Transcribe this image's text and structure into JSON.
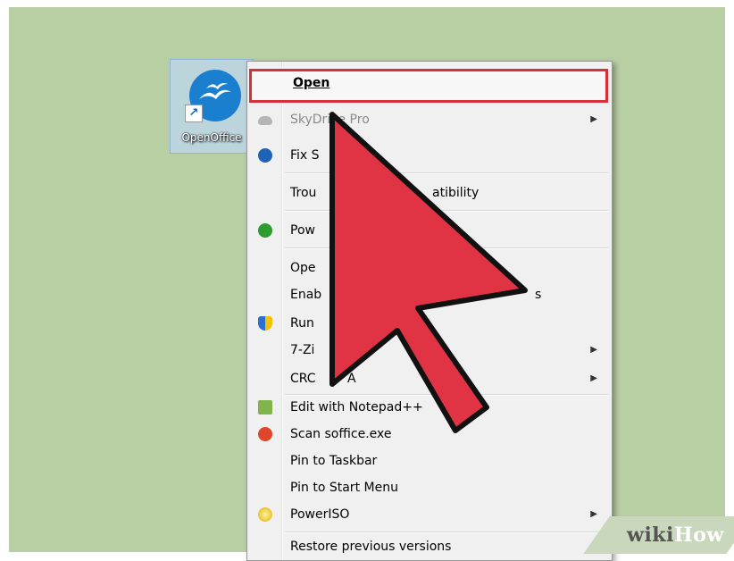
{
  "desktop": {
    "shortcut": {
      "label": "OpenOffice"
    }
  },
  "context_menu": {
    "open": "Open",
    "items": [
      {
        "label": "SkyDrive Pro",
        "icon": "cloud-icon",
        "disabled": true,
        "submenu": true
      },
      {
        "label": "Fix S",
        "icon": "blue-circle-icon"
      },
      {
        "label": "Trou",
        "suffix": "atibility"
      },
      {
        "label": "Pow",
        "icon": "green-power-icon"
      },
      {
        "label": "Ope"
      },
      {
        "label": "Enab",
        "suffix": "s"
      },
      {
        "label": "Run",
        "icon": "shield-icon"
      },
      {
        "label": "7-Zi",
        "submenu": true
      },
      {
        "label": "CRC",
        "suffix": "A",
        "submenu": true
      },
      {
        "label": "Edit with Notepad++",
        "icon": "notepad-icon"
      },
      {
        "label": "Scan soffice.exe",
        "icon": "scan-icon"
      },
      {
        "label": "Pin to Taskbar"
      },
      {
        "label": "Pin to Start Menu"
      },
      {
        "label": "PowerISO",
        "icon": "poweriso-icon",
        "submenu": true
      },
      {
        "label": "Restore previous versions"
      }
    ]
  },
  "watermark": {
    "part1": "wiki",
    "part2": "How"
  },
  "colors": {
    "highlight": "#d7303c",
    "arrow": "#e03344",
    "desktop": "#b8cfa4"
  }
}
